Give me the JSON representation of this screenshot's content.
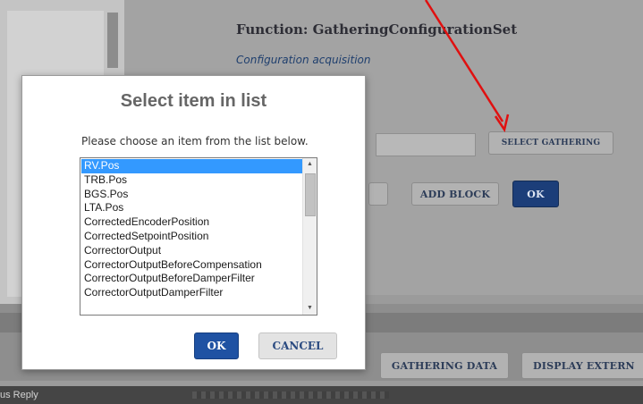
{
  "background": {
    "function_title": "Function: GatheringConfigurationSet",
    "subtitle": "Configuration acquisition",
    "select_gathering_label": "SELECT GATHERING",
    "add_block_label": "ADD BLOCK",
    "ok_label": "OK",
    "gathering_data_label": "GATHERING DATA",
    "display_external_label": "DISPLAY EXTERN"
  },
  "status_bar": {
    "text": "us Reply"
  },
  "dialog": {
    "title": "Select item in list",
    "prompt": "Please choose an item from the list below.",
    "items": [
      "RV.Pos",
      "TRB.Pos",
      "BGS.Pos",
      "LTA.Pos",
      "CorrectedEncoderPosition",
      "CorrectedSetpointPosition",
      "CorrectorOutput",
      "CorrectorOutputBeforeCompensation",
      "CorrectorOutputBeforeDamperFilter",
      "CorrectorOutputDamperFilter"
    ],
    "selected_index": 0,
    "ok_label": "OK",
    "cancel_label": "CANCEL"
  },
  "icons": {
    "scroll_up": "chevron-up-icon",
    "scroll_down": "chevron-down-icon",
    "annotation": "red-arrow-icon"
  },
  "colors": {
    "selection": "#3399ff",
    "primary_button": "#1f52a3",
    "annotation_arrow": "#e01010"
  }
}
